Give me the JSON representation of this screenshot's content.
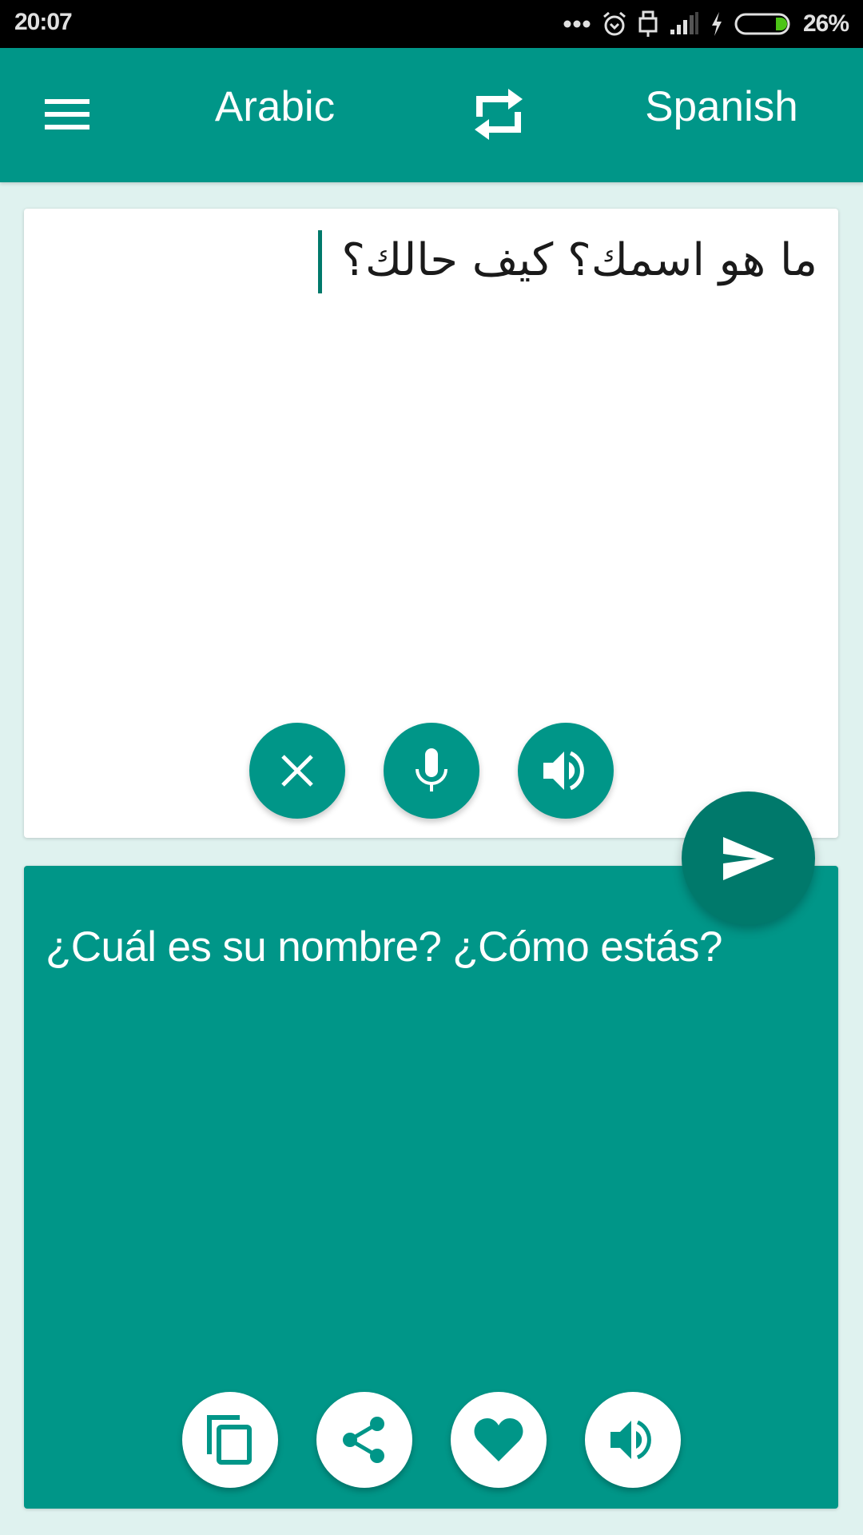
{
  "status_bar": {
    "time": "20:07",
    "battery_percent": "26%",
    "battery_level": 0.26,
    "battery_fill_color": "#4cc417",
    "icons": [
      "more-dots-icon",
      "alarm-icon",
      "usb-icon",
      "signal-icon",
      "charging-bolt-icon",
      "battery-icon"
    ]
  },
  "app_bar": {
    "menu_icon": "hamburger-menu-icon",
    "source_language": "Arabic",
    "swap_icon": "swap-languages-icon",
    "target_language": "Spanish",
    "color": "#009688"
  },
  "input": {
    "text": "ما هو اسمك؟ كيف حالك؟",
    "direction": "rtl",
    "buttons": [
      {
        "name": "clear",
        "icon": "close-icon"
      },
      {
        "name": "voice-input",
        "icon": "microphone-icon"
      },
      {
        "name": "speak-source",
        "icon": "speaker-icon"
      }
    ]
  },
  "translate_button": {
    "icon": "send-icon",
    "color": "#00796b"
  },
  "output": {
    "text": "¿Cuál es su nombre? ¿Cómo estás?",
    "buttons": [
      {
        "name": "copy",
        "icon": "copy-icon"
      },
      {
        "name": "share",
        "icon": "share-icon"
      },
      {
        "name": "favorite",
        "icon": "heart-icon"
      },
      {
        "name": "speak-translation",
        "icon": "speaker-icon"
      }
    ]
  },
  "colors": {
    "primary": "#009688",
    "primary_dark": "#00796b",
    "background": "#dff2ef",
    "card": "#ffffff"
  }
}
